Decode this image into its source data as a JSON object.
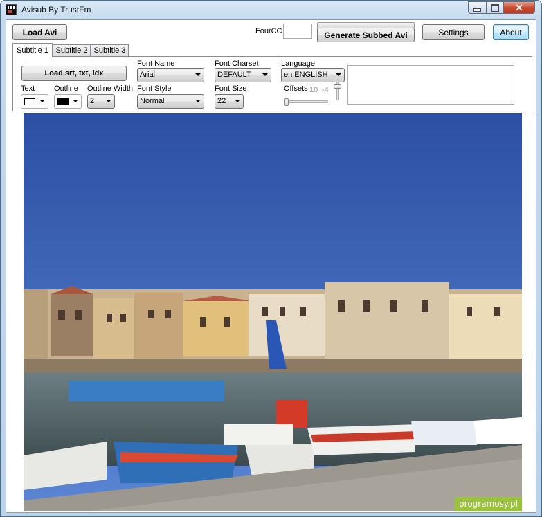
{
  "window": {
    "title": "Avisub By TrustFm",
    "close_glyph": "✕"
  },
  "toolbar": {
    "load_avi": "Load Avi",
    "fourcc_label": "FourCC",
    "fourcc_value": "",
    "generate": "Generate Subbed Avi",
    "settings": "Settings",
    "about": "About"
  },
  "tabs": [
    {
      "label": "Subtitle 1",
      "active": true
    },
    {
      "label": "Subtitle 2",
      "active": false
    },
    {
      "label": "Subtitle 3",
      "active": false
    }
  ],
  "subtitle_panel": {
    "load_subs": "Load srt, txt, idx",
    "text_label": "Text",
    "text_color": "#ffffff",
    "outline_label": "Outline",
    "outline_color": "#000000",
    "outline_width_label": "Outline Width",
    "outline_width_value": "2",
    "font_name_label": "Font Name",
    "font_name_value": "Arial",
    "font_style_label": "Font Style",
    "font_style_value": "Normal",
    "font_charset_label": "Font Charset",
    "font_charset_value": "DEFAULT",
    "font_size_label": "Font Size",
    "font_size_value": "22",
    "language_label": "Language",
    "language_value": "en ENGLISH",
    "offsets_label": "Offsets",
    "offset_x": "10",
    "offset_y": "-4",
    "preview_text": ""
  },
  "preview": {
    "description_icon": "harbor-preview-image",
    "sky_color": "#3a62b5"
  },
  "watermark": "programosy.pl"
}
